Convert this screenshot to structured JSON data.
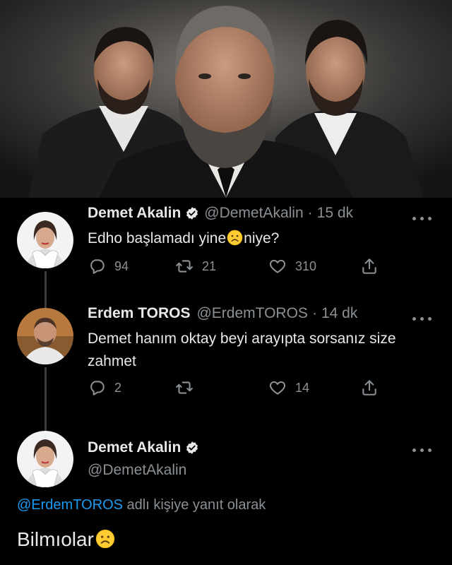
{
  "tweets": [
    {
      "name": "Demet Akalin",
      "handle": "@DemetAkalin",
      "separator": "·",
      "time": "15 dk",
      "text_before_emoji": "Edho başlamadı yine",
      "text_after_emoji": "niye?",
      "replies": "94",
      "retweets": "21",
      "likes": "310"
    },
    {
      "name": "Erdem TOROS",
      "handle": "@ErdemTOROS",
      "separator": "·",
      "time": "14 dk",
      "text": "Demet hanım oktay beyi arayıpta sorsanız size zahmet",
      "replies": "2",
      "retweets": "",
      "likes": "14"
    }
  ],
  "focused_tweet": {
    "name": "Demet Akalin",
    "handle": "@DemetAkalin",
    "reply_to_mention": "@ErdemTOROS",
    "reply_to_suffix": " adlı kişiye yanıt olarak",
    "text": "Bilmıolar"
  },
  "icons": {
    "reply": "reply-icon",
    "retweet": "retweet-icon",
    "like": "heart-icon",
    "share": "share-icon",
    "more": "more-icon",
    "verified": "verified-badge-icon",
    "emoji": "frowning-face-emoji"
  },
  "colors": {
    "background": "#000000",
    "text": "#e7e9ea",
    "muted": "#8b9095",
    "link": "#1d9bf0",
    "thread_line": "#3a3d42"
  }
}
